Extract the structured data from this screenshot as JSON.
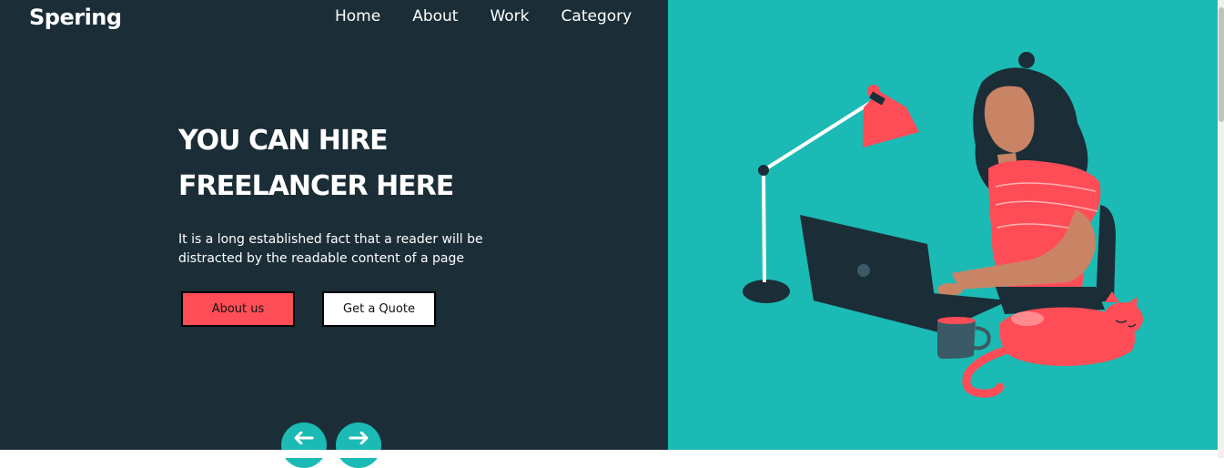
{
  "brand": {
    "name": "Spering"
  },
  "nav": {
    "items": [
      "Home",
      "About",
      "Work",
      "Category"
    ]
  },
  "hero": {
    "headline_line1": "YOU CAN HIRE",
    "headline_line2": "FREELANCER HERE",
    "description": "It is a long established fact that a reader will be distracted by the readable content of a page",
    "primary_button": "About us",
    "secondary_button": "Get a Quote"
  },
  "carousel": {
    "prev_icon": "arrow-left-icon",
    "next_icon": "arrow-right-icon"
  },
  "colors": {
    "dark_panel": "#1b2d37",
    "teal_panel": "#1cbab4",
    "accent_red": "#ff4d57",
    "white": "#ffffff"
  },
  "illustration": {
    "subject": "woman-working-on-laptop-with-cat-illustration"
  }
}
